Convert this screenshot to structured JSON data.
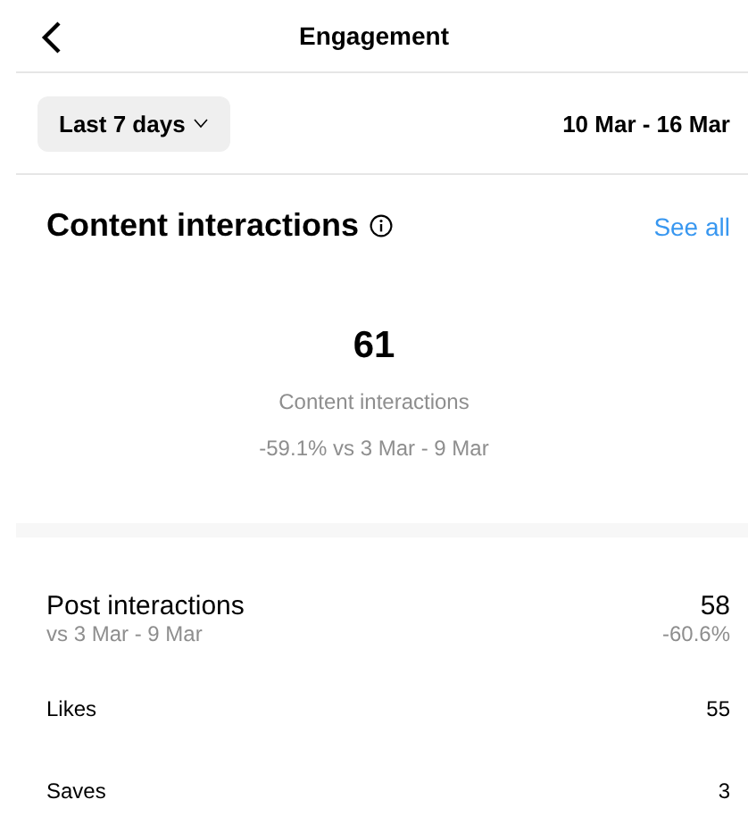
{
  "header": {
    "title": "Engagement"
  },
  "filter": {
    "period": "Last 7 days",
    "range": "10 Mar - 16 Mar"
  },
  "section": {
    "title": "Content interactions",
    "link": "See all"
  },
  "summary": {
    "value": "61",
    "label": "Content interactions",
    "change": "-59.1% vs 3 Mar - 9 Mar"
  },
  "post_interactions": {
    "title": "Post interactions",
    "subtitle": "vs 3 Mar - 9 Mar",
    "value": "58",
    "change": "-60.6%"
  },
  "rows": [
    {
      "label": "Likes",
      "value": "55"
    },
    {
      "label": "Saves",
      "value": "3"
    }
  ]
}
